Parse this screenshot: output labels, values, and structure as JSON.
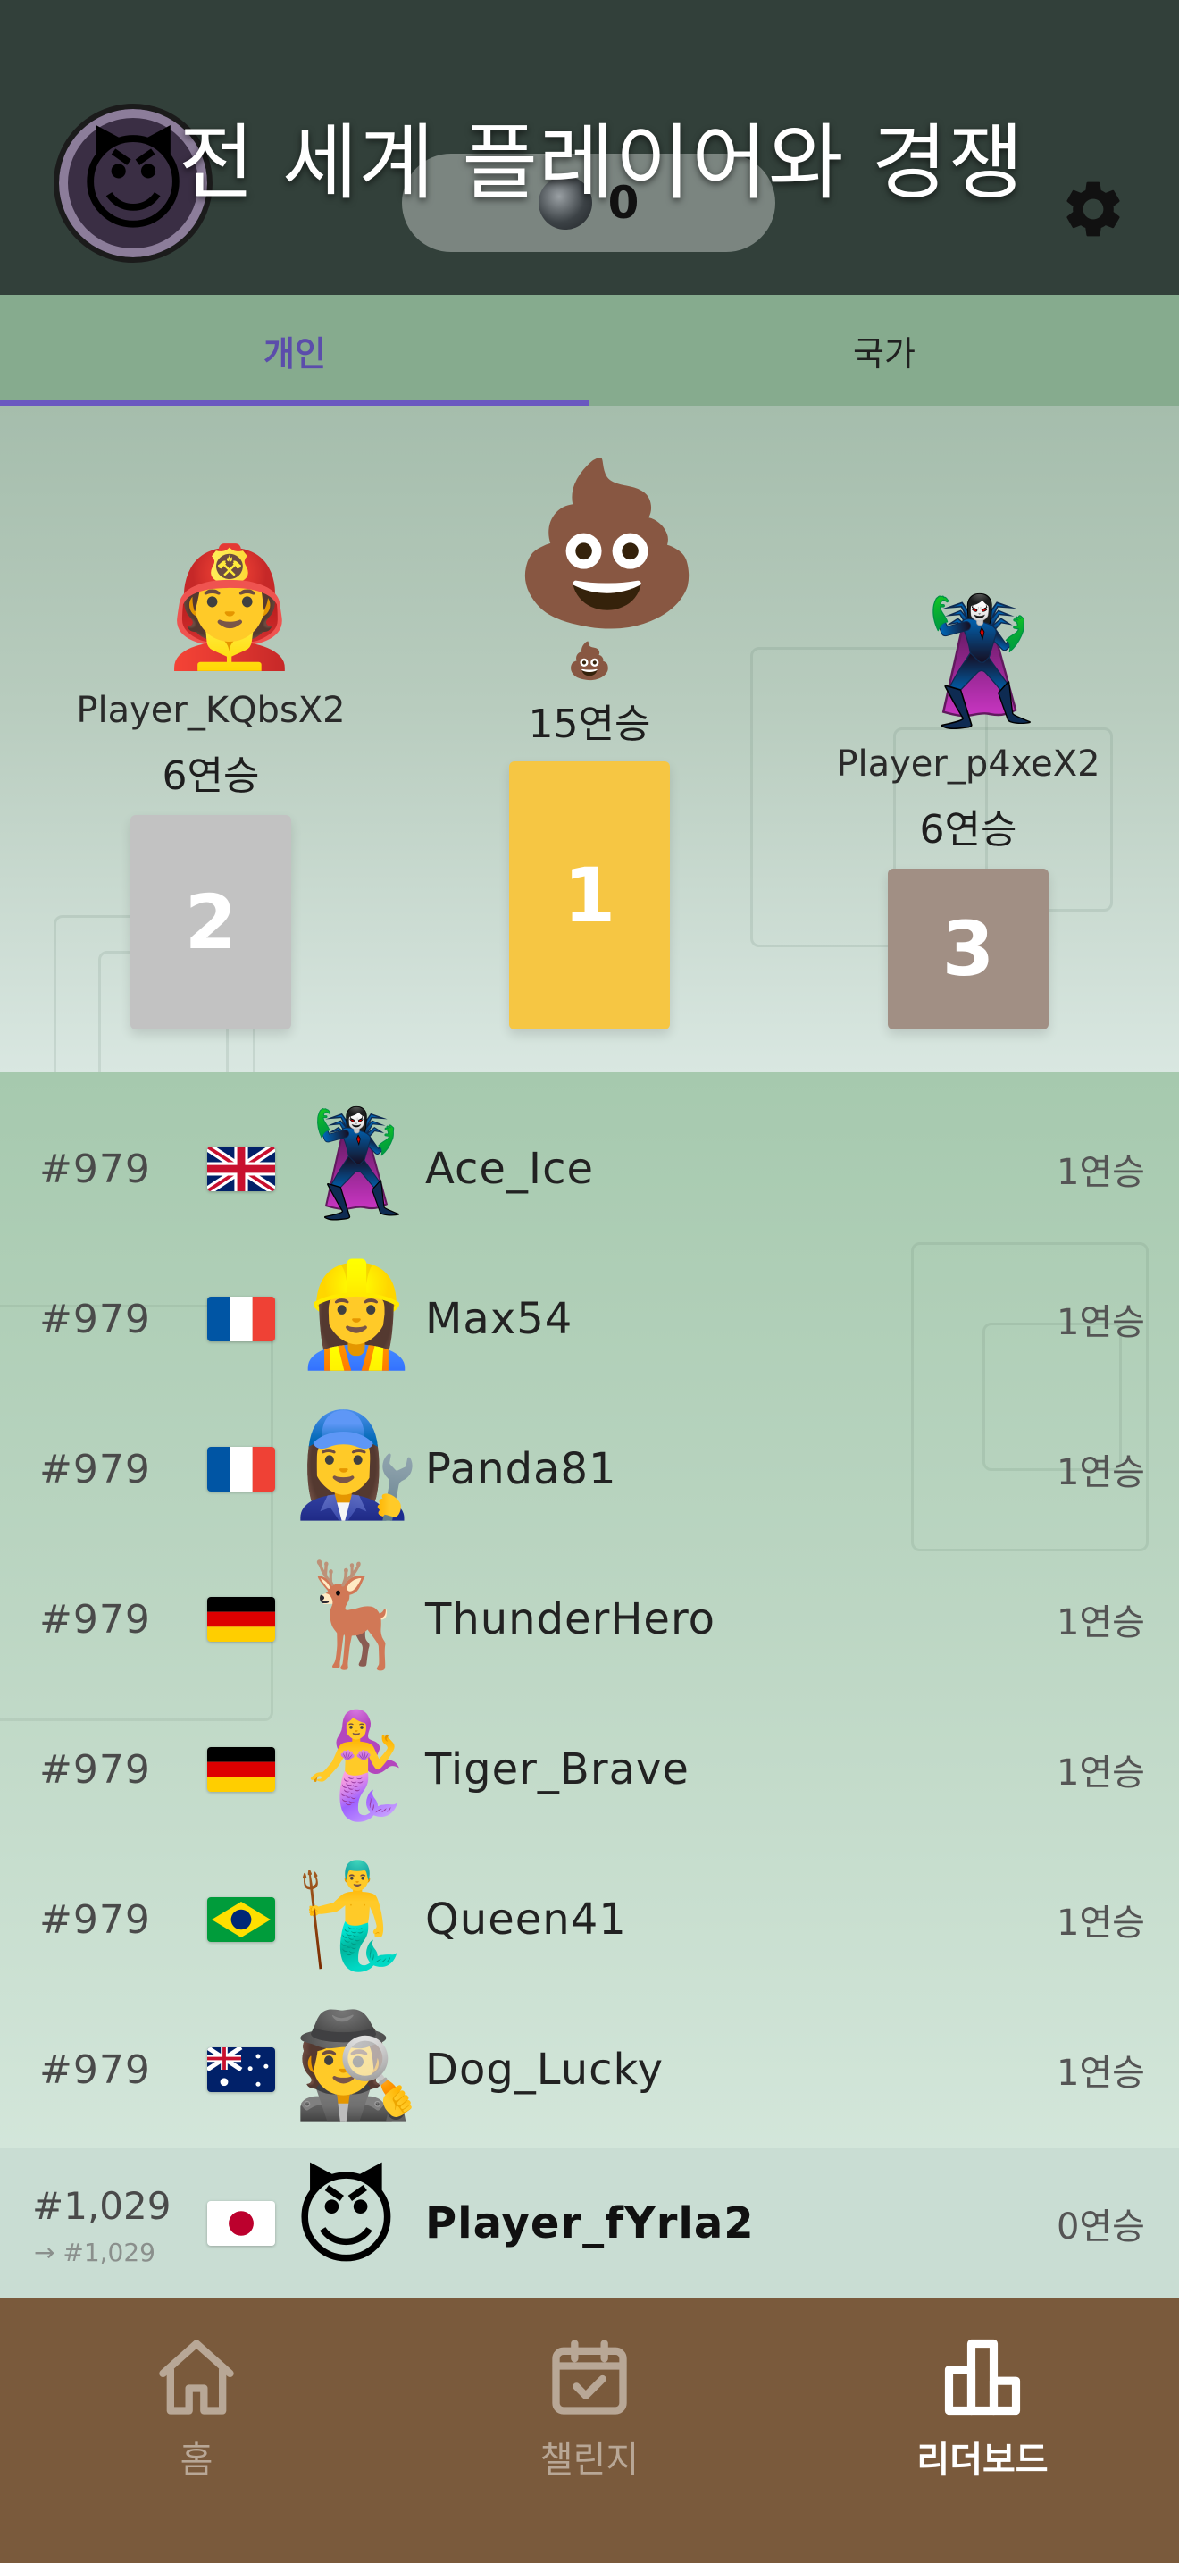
{
  "header": {
    "title": "전 세계 플레이어와 경쟁",
    "coins": "0",
    "avatar_emoji": "😈",
    "coin_icon": "coin-icon",
    "settings_icon": "gear-icon"
  },
  "tabs": [
    {
      "label": "개인",
      "active": true
    },
    {
      "label": "국가",
      "active": false
    }
  ],
  "podium": {
    "first": {
      "emoji": "💩",
      "badge": "💩",
      "streak": "15연승",
      "rank": "1"
    },
    "second": {
      "emoji": "🧑‍🚒",
      "name": "Player_KQbsX2",
      "streak": "6연승",
      "rank": "2"
    },
    "third": {
      "emoji": "🦹‍♀️",
      "name": "Player_p4xeX2",
      "streak": "6연승",
      "rank": "3"
    }
  },
  "leaderboard": [
    {
      "rank": "#979",
      "flag": "uk",
      "emoji": "🦹‍♀️",
      "name": "Ace_Ice",
      "streak": "1연승"
    },
    {
      "rank": "#979",
      "flag": "france",
      "emoji": "👷‍♀️",
      "name": "Max54",
      "streak": "1연승"
    },
    {
      "rank": "#979",
      "flag": "france",
      "emoji": "👩‍🔧",
      "name": "Panda81",
      "streak": "1연승"
    },
    {
      "rank": "#979",
      "flag": "germany",
      "emoji": "🦌",
      "name": "ThunderHero",
      "streak": "1연승"
    },
    {
      "rank": "#979",
      "flag": "germany",
      "emoji": "🧜‍♀️",
      "name": "Tiger_Brave",
      "streak": "1연승"
    },
    {
      "rank": "#979",
      "flag": "brazil",
      "emoji": "🧜‍♂️",
      "name": "Queen41",
      "streak": "1연승"
    },
    {
      "rank": "#979",
      "flag": "australia",
      "emoji": "🕵️",
      "name": "Dog_Lucky",
      "streak": "1연승"
    }
  ],
  "me": {
    "rank": "#1,029",
    "rank_sub": "→ #1,029",
    "flag": "japan",
    "emoji": "😈",
    "name": "Player_fYrla2",
    "streak": "0연승"
  },
  "nav": [
    {
      "label": "홈",
      "icon": "home-icon",
      "active": false
    },
    {
      "label": "챌린지",
      "icon": "calendar-check-icon",
      "active": false
    },
    {
      "label": "리더보드",
      "icon": "leaderboard-icon",
      "active": true
    }
  ],
  "colors": {
    "header_bg": "#32403a",
    "tab_active": "#5b4dab",
    "gold": "#f6c643",
    "silver": "#c2c2c2",
    "bronze": "#a18f84",
    "nav_bg": "#7a5a3c"
  }
}
